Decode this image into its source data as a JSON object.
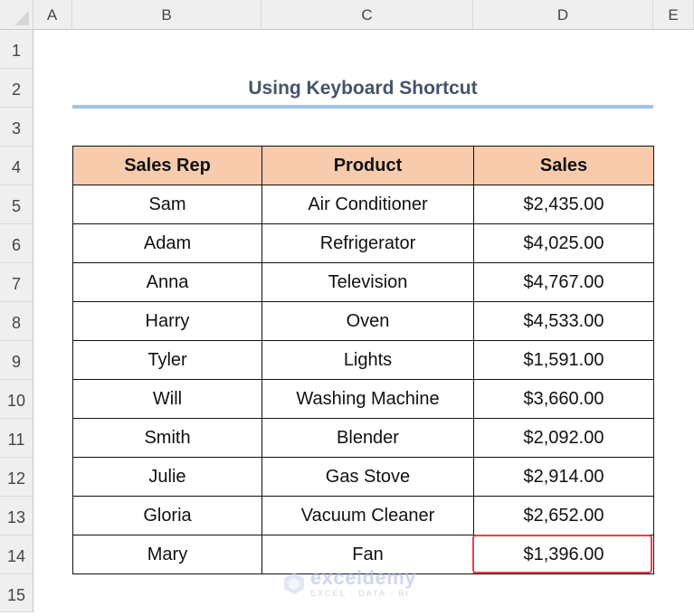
{
  "spreadsheet": {
    "columns": [
      "A",
      "B",
      "C",
      "D",
      "E"
    ],
    "rows": [
      "1",
      "2",
      "3",
      "4",
      "5",
      "6",
      "7",
      "8",
      "9",
      "10",
      "11",
      "12",
      "13",
      "14",
      "15"
    ]
  },
  "title": "Using Keyboard Shortcut",
  "table": {
    "headers": [
      "Sales Rep",
      "Product",
      "Sales"
    ],
    "rows": [
      [
        "Sam",
        "Air Conditioner",
        "$2,435.00"
      ],
      [
        "Adam",
        "Refrigerator",
        "$4,025.00"
      ],
      [
        "Anna",
        "Television",
        "$4,767.00"
      ],
      [
        "Harry",
        "Oven",
        "$4,533.00"
      ],
      [
        "Tyler",
        "Lights",
        "$1,591.00"
      ],
      [
        "Will",
        "Washing Machine",
        "$3,660.00"
      ],
      [
        "Smith",
        "Blender",
        "$2,092.00"
      ],
      [
        "Julie",
        "Gas Stove",
        "$2,914.00"
      ],
      [
        "Gloria",
        "Vacuum Cleaner",
        "$2,652.00"
      ],
      [
        "Mary",
        "Fan",
        "$1,396.00"
      ]
    ],
    "highlighted_cell": "D14"
  },
  "colors": {
    "header_fill": "#f8cbad",
    "title_color": "#44546a",
    "title_underline": "#9dc3e6",
    "highlight_border": "#e8414b"
  },
  "watermark": {
    "name": "exceldemy",
    "tagline": "EXCEL · DATA · BI"
  }
}
